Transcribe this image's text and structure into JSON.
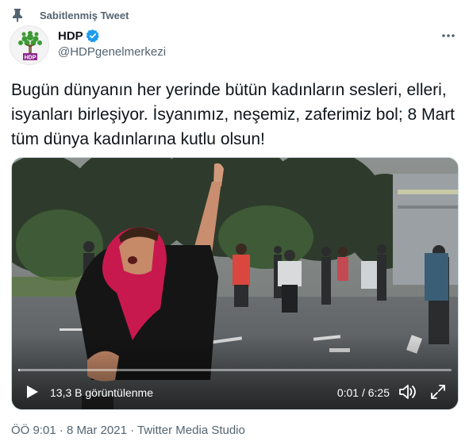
{
  "pinned": {
    "label": "Sabitlenmiş Tweet",
    "icon": "pin-icon"
  },
  "author": {
    "display_name": "HDP",
    "handle": "@HDPgenelmerkezi",
    "verified_icon": "verified-badge-icon",
    "avatar_logo_text": "HDP",
    "verified_color": "#1d9bf0"
  },
  "tweet": {
    "text": "Bugün dünyanın her yerinde bütün kadınların sesleri, elleri, isyanları birleşiyor. İsyanımız, neşemiz, zaferimiz bol; 8 Mart tüm dünya kadınlarına kutlu olsun!"
  },
  "video": {
    "views": "13,3 B görüntülenme",
    "time": "0:01 / 6:25",
    "progress_fraction": 0.003,
    "icons": [
      "play-icon",
      "volume-icon",
      "fullscreen-icon"
    ]
  },
  "meta": {
    "text": "ÖÖ 9:01 · 8 Mar 2021 · Twitter Media Studio"
  },
  "colors": {
    "secondary_text": "#536471",
    "primary_text": "#0f1419",
    "scarf": "#c8194f",
    "brand_green": "#3d9b35",
    "brand_purple": "#8e2a8f"
  }
}
